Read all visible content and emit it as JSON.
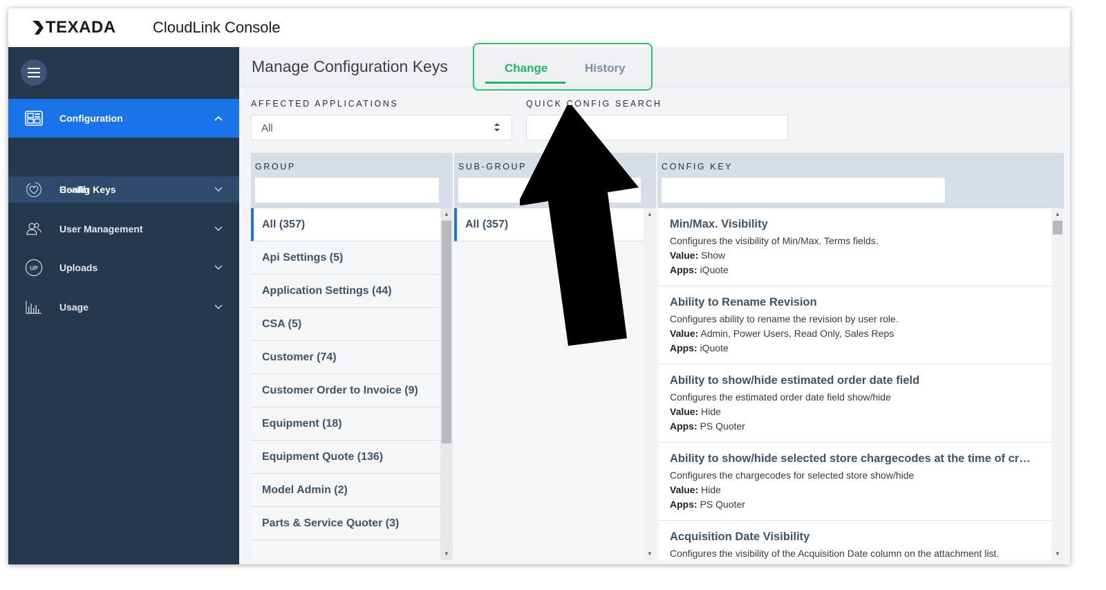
{
  "header": {
    "logo_text": "TEXADA",
    "app_title": "CloudLink Console"
  },
  "sidebar": {
    "items": [
      {
        "label": "Configuration",
        "icon": "dashboard-icon"
      },
      {
        "label": "Health",
        "icon": "heart-pulse-icon"
      },
      {
        "label": "User Management",
        "icon": "users-icon"
      },
      {
        "label": "Uploads",
        "icon": "up-icon",
        "icon_text": "UP"
      },
      {
        "label": "Usage",
        "icon": "bar-chart-icon"
      }
    ],
    "sub_item": "Config Keys"
  },
  "page": {
    "title": "Manage Configuration Keys",
    "tabs": [
      "Change",
      "History"
    ],
    "active_tab": "Change"
  },
  "filters": {
    "affected_label": "AFFECTED APPLICATIONS",
    "affected_value": "All",
    "search_label": "QUICK CONFIG SEARCH",
    "search_value": ""
  },
  "columns": {
    "group": "GROUP",
    "subgroup": "SUB-GROUP",
    "config_key": "CONFIG KEY"
  },
  "groups": [
    "All (357)",
    "Api Settings (5)",
    "Application Settings (44)",
    "CSA (5)",
    "Customer (74)",
    "Customer Order to Invoice (9)",
    "Equipment (18)",
    "Equipment Quote (136)",
    "Model Admin (2)",
    "Parts & Service Quoter (3)"
  ],
  "subgroups": [
    "All (357)"
  ],
  "labels": {
    "value": "Value:",
    "apps": "Apps:"
  },
  "config_keys": [
    {
      "title": "Min/Max. Visibility",
      "desc": "Configures the visibility of Min/Max. Terms fields.",
      "value": "Show",
      "apps": "iQuote"
    },
    {
      "title": "Ability to Rename Revision",
      "desc": "Configures ability to rename the revision by user role.",
      "value": "Admin, Power Users, Read Only, Sales Reps",
      "apps": "iQuote"
    },
    {
      "title": "Ability to show/hide estimated order date field",
      "desc": "Configures the estimated order date field show/hide",
      "value": "Hide",
      "apps": "PS Quoter"
    },
    {
      "title": "Ability to show/hide selected store chargecodes at the time of cr…",
      "desc": "Configures the chargecodes for selected store show/hide",
      "value": "Hide",
      "apps": "PS Quoter"
    },
    {
      "title": "Acquisition Date Visibility",
      "desc": "Configures the visibility of the Acquisition Date column on the attachment list.",
      "value": "",
      "apps": ""
    }
  ],
  "colors": {
    "sidebar_bg": "#24384e",
    "active_blue": "#1a73e8",
    "tab_green": "#22b561",
    "highlight_green": "#27c46b"
  }
}
